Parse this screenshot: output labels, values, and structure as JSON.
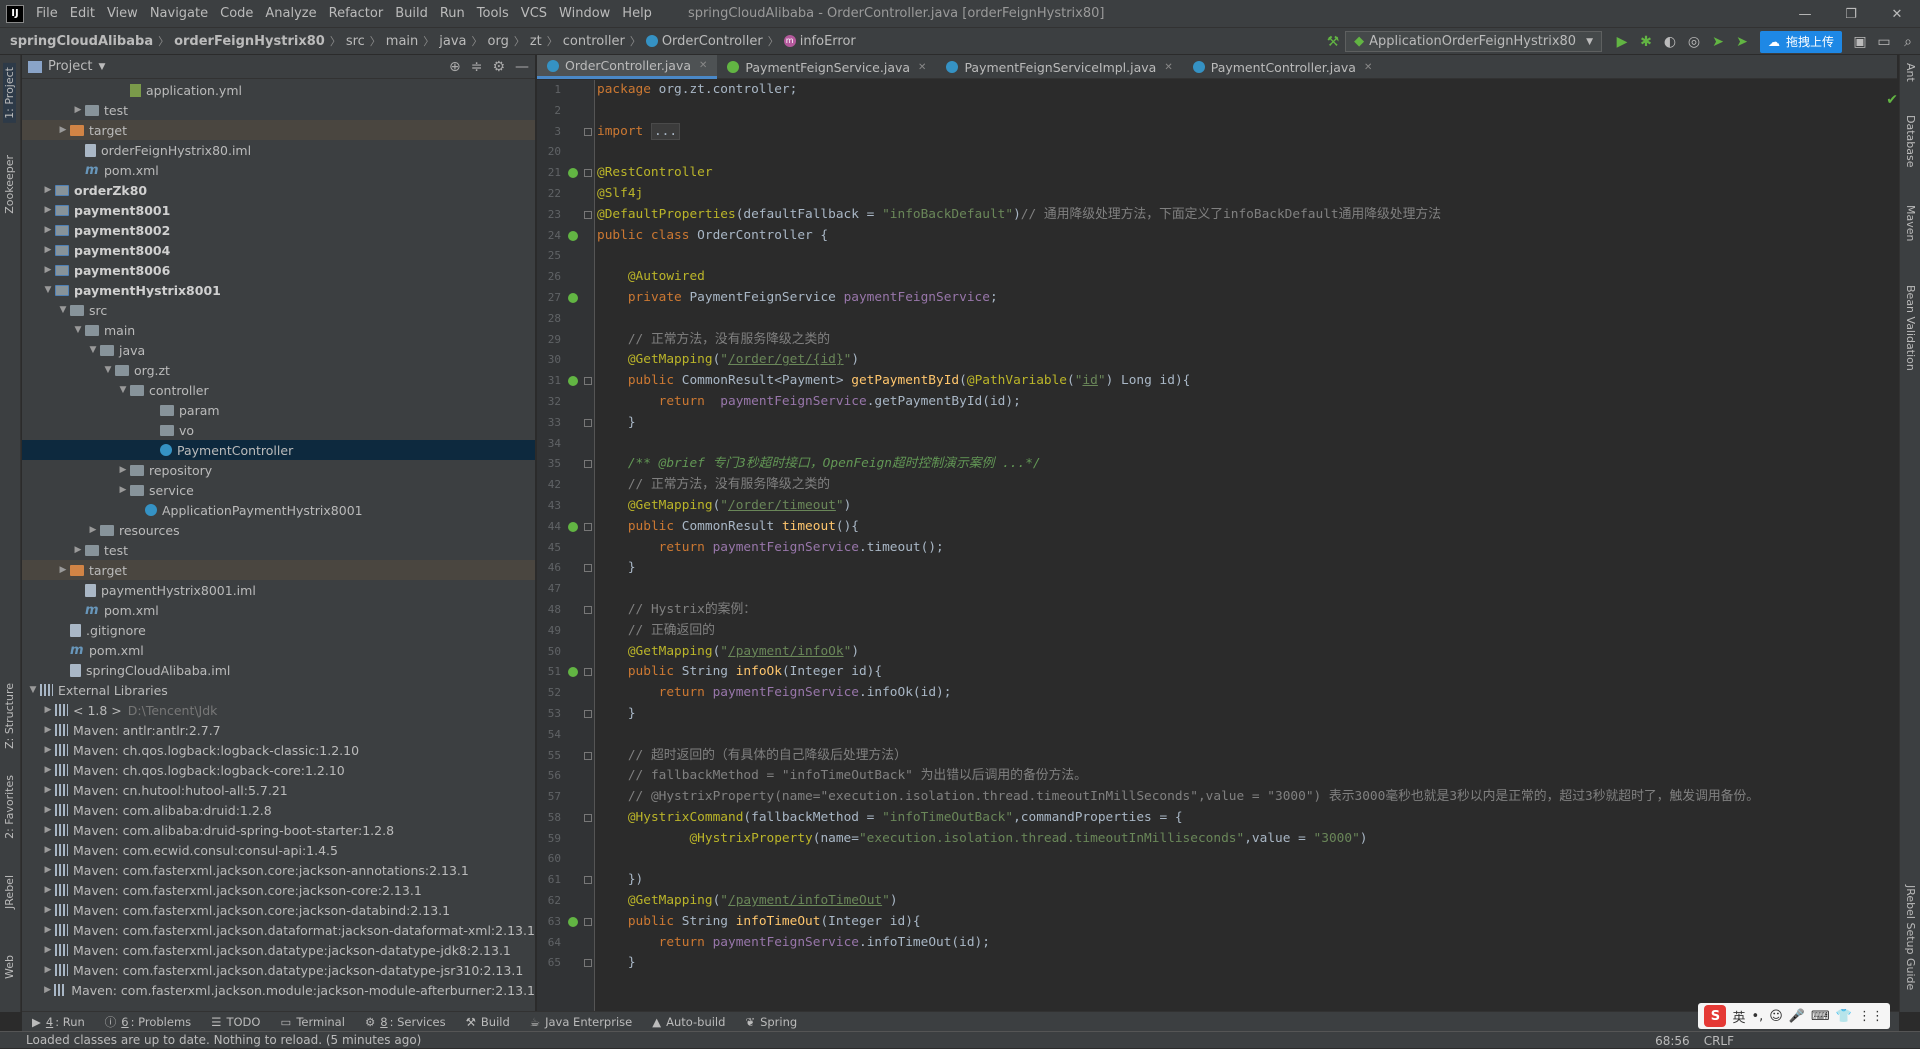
{
  "menu": {
    "items": [
      "File",
      "Edit",
      "View",
      "Navigate",
      "Code",
      "Analyze",
      "Refactor",
      "Build",
      "Run",
      "Tools",
      "VCS",
      "Window",
      "Help"
    ],
    "title": "springCloudAlibaba - OrderController.java [orderFeignHystrix80]"
  },
  "breadcrumb": [
    "springCloudAlibaba",
    "orderFeignHystrix80",
    "src",
    "main",
    "java",
    "org",
    "zt",
    "controller",
    "OrderController",
    "infoError"
  ],
  "run_config": "ApplicationOrderFeignHystrix80",
  "upload_label": "拖拽上传",
  "project_panel": {
    "title": "Project"
  },
  "left_strip": {
    "project": "1: Project",
    "zookeeper": "Zookeeper",
    "structure": "Z: Structure",
    "favorites": "2: Favorites",
    "jrebel": "JRebel",
    "web": "Web"
  },
  "right_strip": {
    "ant": "Ant",
    "database": "Database",
    "maven": "Maven",
    "bean": "Bean Validation",
    "jrebel_guide": "JRebel Setup Guide"
  },
  "tree": [
    {
      "d": 6,
      "t": "application.yml",
      "k": "yml",
      "a": ""
    },
    {
      "d": 3,
      "t": "test",
      "k": "folder",
      "a": ">"
    },
    {
      "d": 2,
      "t": "target",
      "k": "orange",
      "a": ">",
      "tgt": true
    },
    {
      "d": 3,
      "t": "orderFeignHystrix80.iml",
      "k": "file",
      "a": ""
    },
    {
      "d": 3,
      "t": "pom.xml",
      "k": "m",
      "a": ""
    },
    {
      "d": 1,
      "t": "orderZk80",
      "k": "mod",
      "a": ">",
      "b": true
    },
    {
      "d": 1,
      "t": "payment8001",
      "k": "mod",
      "a": ">",
      "b": true
    },
    {
      "d": 1,
      "t": "payment8002",
      "k": "mod",
      "a": ">",
      "b": true
    },
    {
      "d": 1,
      "t": "payment8004",
      "k": "mod",
      "a": ">",
      "b": true
    },
    {
      "d": 1,
      "t": "payment8006",
      "k": "mod",
      "a": ">",
      "b": true
    },
    {
      "d": 1,
      "t": "paymentHystrix8001",
      "k": "mod",
      "a": "v",
      "b": true
    },
    {
      "d": 2,
      "t": "src",
      "k": "folder",
      "a": "v"
    },
    {
      "d": 3,
      "t": "main",
      "k": "folder",
      "a": "v"
    },
    {
      "d": 4,
      "t": "java",
      "k": "folder",
      "a": "v"
    },
    {
      "d": 5,
      "t": "org.zt",
      "k": "folder",
      "a": "v"
    },
    {
      "d": 6,
      "t": "controller",
      "k": "folder",
      "a": "v"
    },
    {
      "d": 8,
      "t": "param",
      "k": "folder",
      "a": ""
    },
    {
      "d": 8,
      "t": "vo",
      "k": "folder",
      "a": ""
    },
    {
      "d": 8,
      "t": "PaymentController",
      "k": "jc",
      "a": "",
      "sel": true
    },
    {
      "d": 6,
      "t": "repository",
      "k": "folder",
      "a": ">"
    },
    {
      "d": 6,
      "t": "service",
      "k": "folder",
      "a": ">"
    },
    {
      "d": 7,
      "t": "ApplicationPaymentHystrix8001",
      "k": "jc",
      "a": ""
    },
    {
      "d": 4,
      "t": "resources",
      "k": "folder",
      "a": ">"
    },
    {
      "d": 3,
      "t": "test",
      "k": "folder",
      "a": ">"
    },
    {
      "d": 2,
      "t": "target",
      "k": "orange",
      "a": ">",
      "tgt": true
    },
    {
      "d": 3,
      "t": "paymentHystrix8001.iml",
      "k": "file",
      "a": ""
    },
    {
      "d": 3,
      "t": "pom.xml",
      "k": "m",
      "a": ""
    },
    {
      "d": 2,
      "t": ".gitignore",
      "k": "file",
      "a": ""
    },
    {
      "d": 2,
      "t": "pom.xml",
      "k": "m",
      "a": ""
    },
    {
      "d": 2,
      "t": "springCloudAlibaba.iml",
      "k": "file",
      "a": ""
    },
    {
      "d": 0,
      "t": "External Libraries",
      "k": "lib",
      "a": "v"
    },
    {
      "d": 1,
      "t": "< 1.8 >",
      "k": "lib",
      "a": ">",
      "dim": "D:\\Tencent\\Jdk"
    },
    {
      "d": 1,
      "t": "Maven: antlr:antlr:2.7.7",
      "k": "lib",
      "a": ">"
    },
    {
      "d": 1,
      "t": "Maven: ch.qos.logback:logback-classic:1.2.10",
      "k": "lib",
      "a": ">"
    },
    {
      "d": 1,
      "t": "Maven: ch.qos.logback:logback-core:1.2.10",
      "k": "lib",
      "a": ">"
    },
    {
      "d": 1,
      "t": "Maven: cn.hutool:hutool-all:5.7.21",
      "k": "lib",
      "a": ">"
    },
    {
      "d": 1,
      "t": "Maven: com.alibaba:druid:1.2.8",
      "k": "lib",
      "a": ">"
    },
    {
      "d": 1,
      "t": "Maven: com.alibaba:druid-spring-boot-starter:1.2.8",
      "k": "lib",
      "a": ">"
    },
    {
      "d": 1,
      "t": "Maven: com.ecwid.consul:consul-api:1.4.5",
      "k": "lib",
      "a": ">"
    },
    {
      "d": 1,
      "t": "Maven: com.fasterxml.jackson.core:jackson-annotations:2.13.1",
      "k": "lib",
      "a": ">"
    },
    {
      "d": 1,
      "t": "Maven: com.fasterxml.jackson.core:jackson-core:2.13.1",
      "k": "lib",
      "a": ">"
    },
    {
      "d": 1,
      "t": "Maven: com.fasterxml.jackson.core:jackson-databind:2.13.1",
      "k": "lib",
      "a": ">"
    },
    {
      "d": 1,
      "t": "Maven: com.fasterxml.jackson.dataformat:jackson-dataformat-xml:2.13.1",
      "k": "lib",
      "a": ">"
    },
    {
      "d": 1,
      "t": "Maven: com.fasterxml.jackson.datatype:jackson-datatype-jdk8:2.13.1",
      "k": "lib",
      "a": ">"
    },
    {
      "d": 1,
      "t": "Maven: com.fasterxml.jackson.datatype:jackson-datatype-jsr310:2.13.1",
      "k": "lib",
      "a": ">"
    },
    {
      "d": 1,
      "t": "Maven: com.fasterxml.jackson.module:jackson-module-afterburner:2.13.1",
      "k": "lib",
      "a": ">"
    }
  ],
  "tabs": [
    {
      "label": "OrderController.java",
      "icon": "c",
      "active": true
    },
    {
      "label": "PaymentFeignService.java",
      "icon": "i",
      "active": false
    },
    {
      "label": "PaymentFeignServiceImpl.java",
      "icon": "c",
      "active": false
    },
    {
      "label": "PaymentController.java",
      "icon": "c",
      "active": false
    }
  ],
  "code": [
    {
      "n": "1",
      "h": "<span class=\"kw\">package</span> org.zt.controller;"
    },
    {
      "n": "2",
      "h": ""
    },
    {
      "n": "3",
      "h": "<span class=\"kw\">import</span> <span class=\"fldr\">...</span>",
      "f": true
    },
    {
      "n": "20",
      "h": ""
    },
    {
      "n": "21",
      "h": "<span class=\"an\">@RestController</span>",
      "g": true,
      "f": true
    },
    {
      "n": "22",
      "h": "<span class=\"an\">@Slf4j</span>"
    },
    {
      "n": "23",
      "h": "<span class=\"an\">@DefaultProperties</span>(defaultFallback = <span class=\"str\">\"infoBackDefault\"</span>)<span class=\"cm\">// 通用降级处理方法，下面定义了infoBackDefault通用降级处理方法</span>",
      "f": true
    },
    {
      "n": "24",
      "h": "<span class=\"kw\">public class</span> OrderController {",
      "g": true
    },
    {
      "n": "25",
      "h": ""
    },
    {
      "n": "26",
      "h": "    <span class=\"an\">@Autowired</span>"
    },
    {
      "n": "27",
      "h": "    <span class=\"kw\">private</span> PaymentFeignService <span class=\"fld\">paymentFeignService</span>;",
      "g": true
    },
    {
      "n": "28",
      "h": ""
    },
    {
      "n": "29",
      "h": "    <span class=\"cm\">// 正常方法，没有服务降级之类的</span>"
    },
    {
      "n": "30",
      "h": "    <span class=\"an\">@GetMapping</span>(<span class=\"str\">\"<span class=\"lk\">/order/get/{id}</span>\"</span>)"
    },
    {
      "n": "31",
      "h": "    <span class=\"kw\">public</span> CommonResult&lt;Payment&gt; <span class=\"fn\">getPaymentById</span>(<span class=\"an\">@PathVariable</span>(<span class=\"str\">\"<span class=\"lk\">id</span>\"</span>) Long id){",
      "g": true,
      "f": true
    },
    {
      "n": "32",
      "h": "        <span class=\"kw\">return</span>  <span class=\"fld\">paymentFeignService</span>.getPaymentById(id);"
    },
    {
      "n": "33",
      "h": "    }",
      "f": true
    },
    {
      "n": "34",
      "h": ""
    },
    {
      "n": "35",
      "h": "    <span class=\"doc\">/** @brief 专门3秒超时接口，OpenFeign超时控制演示案例 ...*/</span>",
      "f": true
    },
    {
      "n": "42",
      "h": "    <span class=\"cm\">// 正常方法，没有服务降级之类的</span>"
    },
    {
      "n": "43",
      "h": "    <span class=\"an\">@GetMapping</span>(<span class=\"str\">\"<span class=\"lk\">/order/timeout</span>\"</span>)"
    },
    {
      "n": "44",
      "h": "    <span class=\"kw\">public</span> CommonResult <span class=\"fn\">timeout</span>(){",
      "g": true,
      "f": true
    },
    {
      "n": "45",
      "h": "        <span class=\"kw\">return</span> <span class=\"fld\">paymentFeignService</span>.timeout();"
    },
    {
      "n": "46",
      "h": "    }",
      "f": true
    },
    {
      "n": "47",
      "h": ""
    },
    {
      "n": "48",
      "h": "    <span class=\"cm\">// Hystrix的案例：</span>",
      "f": true
    },
    {
      "n": "49",
      "h": "    <span class=\"cm\">// 正确返回的</span>"
    },
    {
      "n": "50",
      "h": "    <span class=\"an\">@GetMapping</span>(<span class=\"str\">\"<span class=\"lk\">/payment/infoOk</span>\"</span>)"
    },
    {
      "n": "51",
      "h": "    <span class=\"kw\">public</span> String <span class=\"fn\">infoOk</span>(Integer id){",
      "g": true,
      "f": true
    },
    {
      "n": "52",
      "h": "        <span class=\"kw\">return</span> <span class=\"fld\">paymentFeignService</span>.infoOk(id);"
    },
    {
      "n": "53",
      "h": "    }",
      "f": true
    },
    {
      "n": "54",
      "h": ""
    },
    {
      "n": "55",
      "h": "    <span class=\"cm\">// 超时返回的（有具体的自己降级后处理方法）</span>",
      "f": true
    },
    {
      "n": "56",
      "h": "    <span class=\"cm\">// fallbackMethod = \"infoTimeOutBack\" 为出错以后调用的备份方法。</span>"
    },
    {
      "n": "57",
      "h": "    <span class=\"cm\">// @HystrixProperty(name=\"execution.isolation.thread.timeoutInMillSeconds\",value = \"3000\") 表示3000毫秒也就是3秒以内是正常的，超过3秒就超时了，触发调用备份。</span>"
    },
    {
      "n": "58",
      "h": "    <span class=\"an\">@HystrixCommand</span>(fallbackMethod = <span class=\"str\">\"infoTimeOutBack\"</span>,commandProperties = {",
      "f": true
    },
    {
      "n": "59",
      "h": "            <span class=\"an\">@HystrixProperty</span>(name=<span class=\"str\">\"execution.isolation.thread.timeoutInMilliseconds\"</span>,value = <span class=\"str\">\"3000\"</span>)"
    },
    {
      "n": "60",
      "h": ""
    },
    {
      "n": "61",
      "h": "    })",
      "f": true
    },
    {
      "n": "62",
      "h": "    <span class=\"an\">@GetMapping</span>(<span class=\"str\">\"<span class=\"lk\">/payment/infoTimeOut</span>\"</span>)"
    },
    {
      "n": "63",
      "h": "    <span class=\"kw\">public</span> String <span class=\"fn\">infoTimeOut</span>(Integer id){",
      "g": true,
      "f": true
    },
    {
      "n": "64",
      "h": "        <span class=\"kw\">return</span> <span class=\"fld\">paymentFeignService</span>.infoTimeOut(id);"
    },
    {
      "n": "65",
      "h": "    }",
      "f": true
    }
  ],
  "bottom_tools": [
    {
      "u": "4",
      "label": ": Run"
    },
    {
      "u": "6",
      "label": ": Problems"
    },
    {
      "u": "",
      "label": "TODO"
    },
    {
      "u": "",
      "label": "Terminal"
    },
    {
      "u": "8",
      "label": ": Services"
    },
    {
      "u": "",
      "label": "Build"
    },
    {
      "u": "",
      "label": "Java Enterprise"
    },
    {
      "u": "",
      "label": "Auto-build"
    },
    {
      "u": "",
      "label": "Spring"
    }
  ],
  "status": {
    "message": "Loaded classes are up to date. Nothing to reload. (5 minutes ago)",
    "position": "68:56",
    "line_sep": "CRLF"
  },
  "ime": {
    "logo": "S",
    "lang": "英"
  }
}
